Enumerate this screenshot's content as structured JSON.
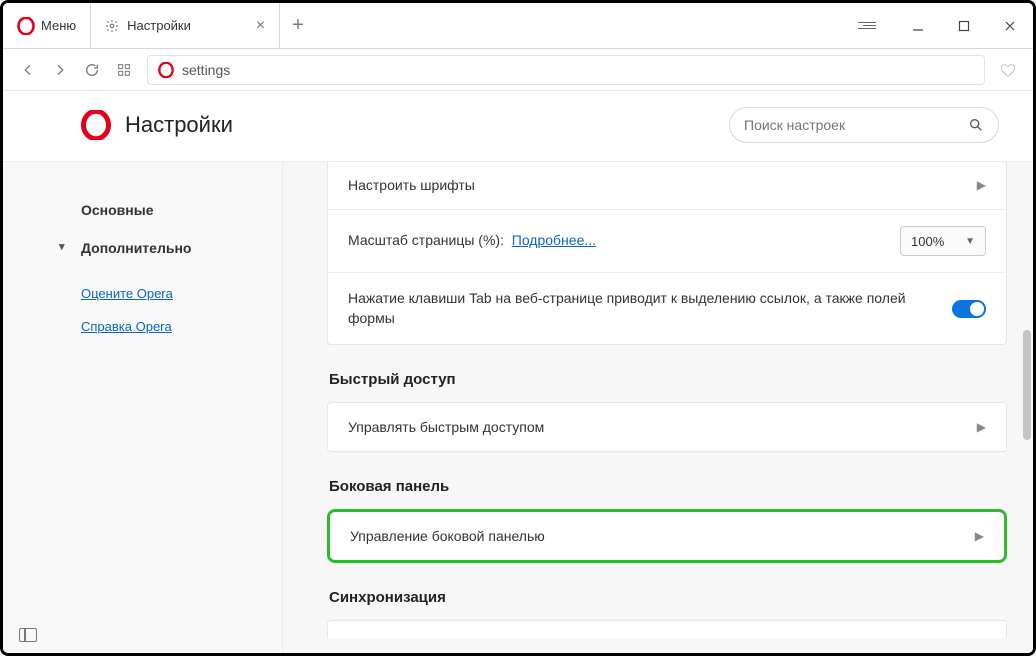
{
  "window": {
    "menu_label": "Меню",
    "tab_title": "Настройки",
    "address": "settings"
  },
  "header": {
    "title": "Настройки",
    "search_placeholder": "Поиск настроек"
  },
  "sidebar": {
    "items": [
      {
        "label": "Основные",
        "type": "item"
      },
      {
        "label": "Дополнительно",
        "type": "expandable"
      }
    ],
    "links": [
      {
        "label": "Оцените Opera"
      },
      {
        "label": "Справка Opera"
      }
    ]
  },
  "main": {
    "card1": {
      "row1_label": "Настроить шрифты",
      "row2_label": "Масштаб страницы (%):",
      "row2_link": "Подробнее...",
      "row2_zoom": "100%",
      "row3_text": "Нажатие клавиши Tab на веб-странице приводит к выделению ссылок, а также полей формы"
    },
    "section_speeddial": {
      "title": "Быстрый доступ",
      "row_label": "Управлять быстрым доступом"
    },
    "section_sidebar": {
      "title": "Боковая панель",
      "row_label": "Управление боковой панелью"
    },
    "section_sync": {
      "title": "Синхронизация"
    }
  }
}
